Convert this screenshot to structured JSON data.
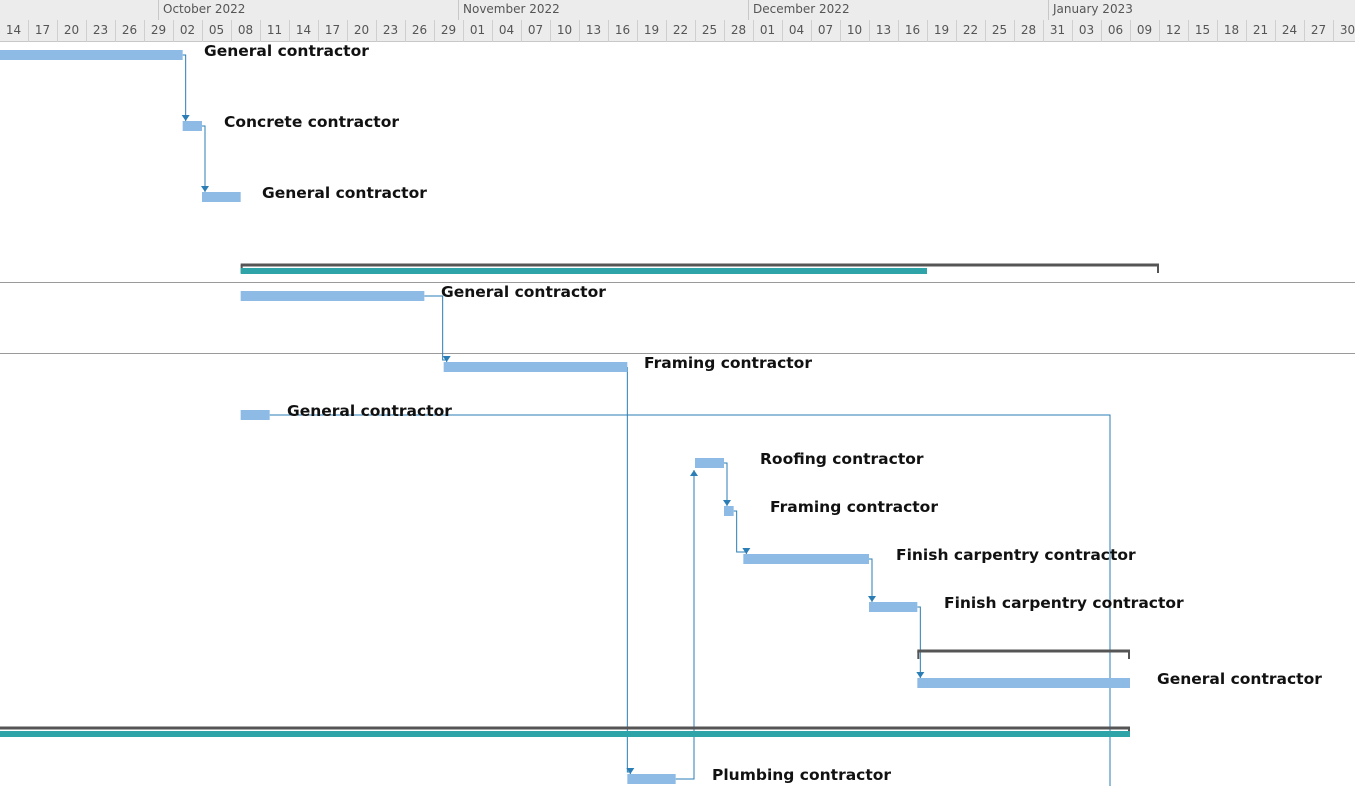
{
  "timescale": {
    "months": [
      {
        "label": "October 2022",
        "start": "2022-10-01"
      },
      {
        "label": "November 2022",
        "start": "2022-11-01"
      },
      {
        "label": "December 2022",
        "start": "2022-12-01"
      },
      {
        "label": "January 2023",
        "start": "2023-01-01"
      }
    ],
    "day_ticks": [
      "14",
      "17",
      "20",
      "23",
      "26",
      "29",
      "02",
      "05",
      "08",
      "11",
      "14",
      "17",
      "20",
      "23",
      "26",
      "29",
      "01",
      "04",
      "07",
      "10",
      "13",
      "16",
      "19",
      "22",
      "25",
      "28",
      "01",
      "04",
      "07",
      "10",
      "13",
      "16",
      "19",
      "22",
      "25",
      "28",
      "31",
      "03",
      "06",
      "09",
      "12",
      "15",
      "18",
      "21",
      "24",
      "27",
      "30"
    ],
    "first_tick_date": "2022-09-14"
  },
  "colors": {
    "task_bar": "#8dbbe6",
    "summary_progress": "#2ea3a8",
    "summary_bracket": "#555555",
    "link": "#2a7db5",
    "row_divider": "#9a9a9a"
  },
  "tasks": [
    {
      "id": "t1",
      "resource": "General contractor",
      "start": "2022-09-12",
      "finish": "2022-10-03"
    },
    {
      "id": "t2",
      "resource": "Concrete contractor",
      "start": "2022-10-03",
      "finish": "2022-10-05"
    },
    {
      "id": "t3",
      "resource": "General contractor",
      "start": "2022-10-05",
      "finish": "2022-10-09"
    },
    {
      "id": "t5",
      "resource": "General contractor",
      "start": "2022-10-09",
      "finish": "2022-10-28"
    },
    {
      "id": "t6",
      "resource": "Framing contractor",
      "start": "2022-10-30",
      "finish": "2022-11-18"
    },
    {
      "id": "t7",
      "resource": "General contractor",
      "start": "2022-10-09",
      "finish": "2022-10-12"
    },
    {
      "id": "t8",
      "resource": "Roofing contractor",
      "start": "2022-11-25",
      "finish": "2022-11-28"
    },
    {
      "id": "t9",
      "resource": "Framing contractor",
      "start": "2022-11-28",
      "finish": "2022-11-29"
    },
    {
      "id": "t10",
      "resource": "Finish carpentry contractor",
      "start": "2022-11-30",
      "finish": "2022-12-13"
    },
    {
      "id": "t11",
      "resource": "Finish carpentry contractor",
      "start": "2022-12-13",
      "finish": "2022-12-18"
    },
    {
      "id": "t13",
      "resource": "General contractor",
      "start": "2022-12-18",
      "finish": "2023-01-09"
    },
    {
      "id": "t15",
      "resource": "Plumbing contractor",
      "start": "2022-11-18",
      "finish": "2022-11-23"
    }
  ],
  "summaries": [
    {
      "id": "s1",
      "start": "2022-10-09",
      "finish": "2023-01-12",
      "progress_to": "2022-12-19"
    },
    {
      "id": "s2",
      "start": "2022-12-18",
      "finish": "2023-01-09",
      "progress_to": null
    },
    {
      "id": "s3",
      "start": "2022-09-01",
      "finish": "2023-01-09",
      "progress_to": "2023-01-09"
    }
  ]
}
